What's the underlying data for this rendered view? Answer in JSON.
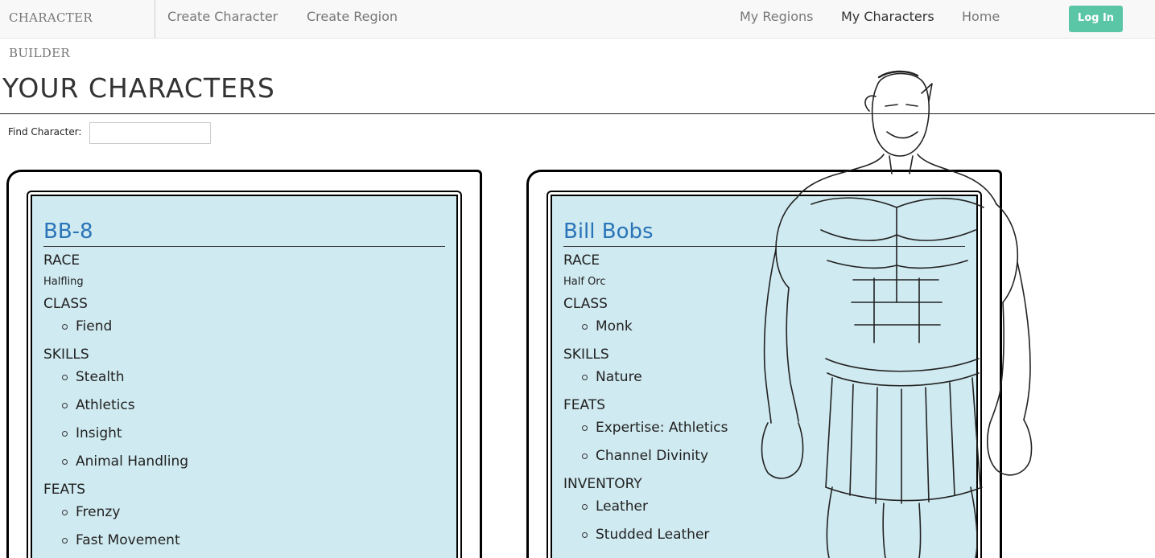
{
  "nav": {
    "brand": "CHARACTER BUILDER",
    "left_links": [
      "Create Character",
      "Create Region"
    ],
    "right_links": [
      "My Regions",
      "My Characters",
      "Home"
    ],
    "login": "Log In"
  },
  "page": {
    "title": "YOUR CHARACTERS",
    "find_label": "Find Character:",
    "find_value": ""
  },
  "characters": [
    {
      "name": "BB-8",
      "race_label": "RACE",
      "race": "Halfling",
      "class_label": "CLASS",
      "classes": [
        "Fiend"
      ],
      "skills_label": "SKILLS",
      "skills": [
        "Stealth",
        "Athletics",
        "Insight",
        "Animal Handling"
      ],
      "feats_label": "FEATS",
      "feats": [
        "Frenzy",
        "Fast Movement"
      ]
    },
    {
      "name": "Bill Bobs",
      "race_label": "RACE",
      "race": "Half Orc",
      "class_label": "CLASS",
      "classes": [
        "Monk"
      ],
      "skills_label": "SKILLS",
      "skills": [
        "Nature"
      ],
      "feats_label": "FEATS",
      "feats": [
        "Expertise: Athletics",
        "Channel Divinity"
      ],
      "inventory_label": "INVENTORY",
      "inventory": [
        "Leather",
        "Studded Leather"
      ]
    }
  ],
  "colors": {
    "card_bg": "#cfeaf0",
    "name": "#2a74b8",
    "login_bg": "#5bc6a6"
  }
}
